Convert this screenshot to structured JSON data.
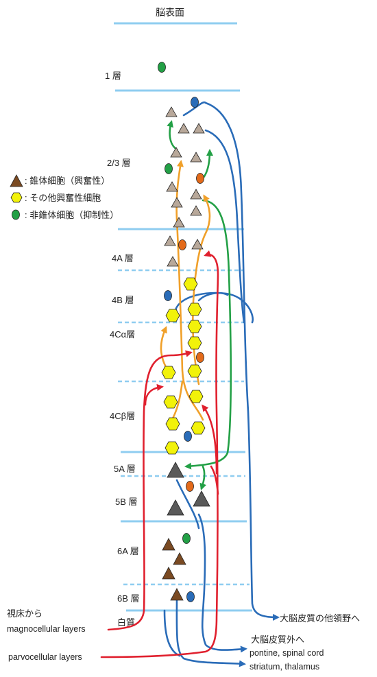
{
  "title": "脳表面",
  "layers": [
    {
      "id": "L1",
      "label": "1 層"
    },
    {
      "id": "L23",
      "label": "2/3 層"
    },
    {
      "id": "L4A",
      "label": "4A 層"
    },
    {
      "id": "L4B",
      "label": "4B 層"
    },
    {
      "id": "L4Ca",
      "label": "4Cα層"
    },
    {
      "id": "L4Cb",
      "label": "4Cβ層"
    },
    {
      "id": "L5A",
      "label": "5A 層"
    },
    {
      "id": "L5B",
      "label": "5B 層"
    },
    {
      "id": "L6A",
      "label": "6A 層"
    },
    {
      "id": "L6B",
      "label": "6B 層"
    },
    {
      "id": "WM",
      "label": "白質"
    }
  ],
  "legend": {
    "pyramidal": ": 錐体細胞（興奮性）",
    "other_excitatory": ": その他興奮性細胞",
    "non_pyramidal": ": 非錐体細胞（抑制性）"
  },
  "inputs": {
    "thalamus_from": "視床から",
    "magnocellular": "magnocellular layers",
    "parvocellular": "parvocellular layers"
  },
  "outputs": {
    "other_cortex": "大脳皮質の他領野へ",
    "extra_cortex": "大脳皮質外へ",
    "pontine": "pontine, spinal cord",
    "striatum": "striatum, thalamus"
  },
  "colors": {
    "layer_line": "#8fcdf0",
    "input_red": "#e0202e",
    "excitatory_orange": "#f0a02a",
    "green": "#23a046",
    "blue": "#2a6cb8",
    "pyramid_dark": "#5a5a5a",
    "pyramid_brown": "#7a4a22",
    "pyramid_light": "#b8a89a",
    "hex_yellow": "#f2f20a"
  }
}
